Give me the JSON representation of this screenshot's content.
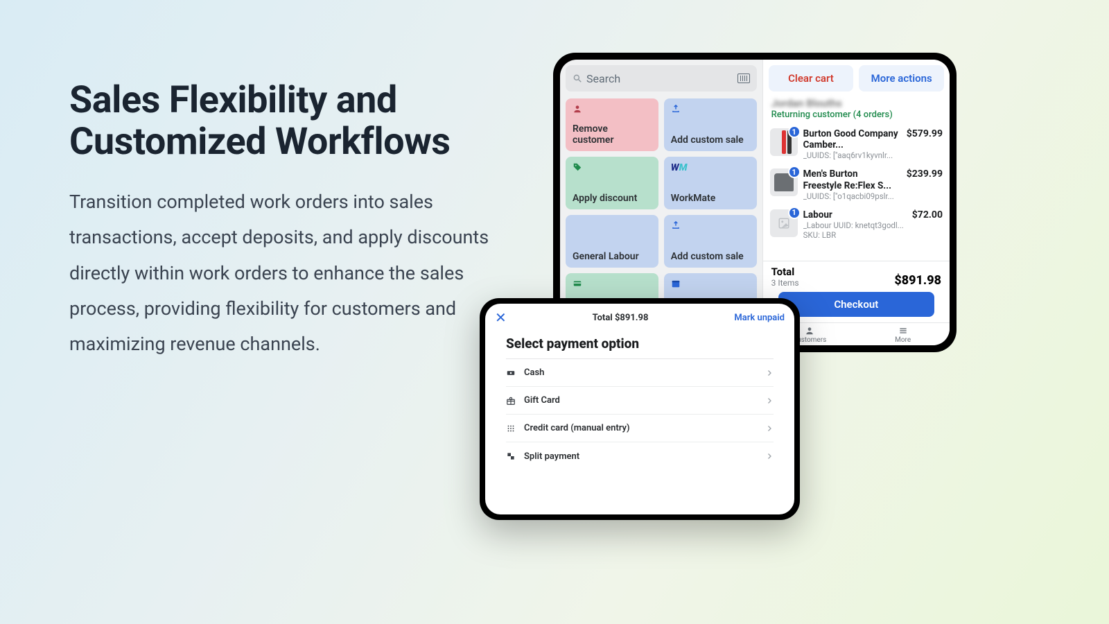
{
  "marketing": {
    "headline": "Sales Flexibility and Customized Workflows",
    "body": "Transition completed work orders into sales transactions, accept deposits, and apply discounts directly within work orders to enhance the sales process, providing flexibility for customers and maximizing revenue channels."
  },
  "pos": {
    "search_placeholder": "Search",
    "tiles": [
      {
        "label": "Remove customer",
        "icon": "person-icon",
        "color": "tile-pink"
      },
      {
        "label": "Add custom sale",
        "icon": "upload-icon",
        "color": "tile-blue"
      },
      {
        "label": "Apply discount",
        "icon": "tag-icon",
        "color": "tile-green"
      },
      {
        "label": "WorkMate",
        "icon": "workmate-logo",
        "color": "tile-blue2"
      },
      {
        "label": "General Labour",
        "icon": "",
        "color": "tile-blue"
      },
      {
        "label": "Add custom sale",
        "icon": "upload-icon",
        "color": "tile-blue"
      },
      {
        "label": "",
        "icon": "card-icon",
        "color": "tile-green"
      },
      {
        "label": "",
        "icon": "calendar-icon",
        "color": "tile-blue"
      }
    ],
    "cart": {
      "clear_label": "Clear cart",
      "more_label": "More actions",
      "customer_name_blurred": "Jordan Blouths",
      "customer_status": "Returning customer (4 orders)",
      "items": [
        {
          "qty": 1,
          "title": "Burton Good Company Camber...",
          "sub": "_UUIDS: [\"aaq6rv1kyvnlr...",
          "price": "$579.99",
          "thumb": "ski"
        },
        {
          "qty": 1,
          "title": "Men's Burton Freestyle Re:Flex S...",
          "sub": "_UUIDS: [\"o1qacbi09pslr...",
          "price": "$239.99",
          "thumb": "boot"
        },
        {
          "qty": 1,
          "title": "Labour",
          "sub": "_Labour UUID: knetqt3godl...",
          "sub2": "SKU: LBR",
          "price": "$72.00",
          "thumb": "placeholder"
        }
      ],
      "total_label": "Total",
      "items_count_label": "3 Items",
      "total_amount": "$891.98",
      "checkout_label": "Checkout"
    },
    "nav": {
      "customers": "Customers",
      "more": "More"
    }
  },
  "payment": {
    "close_glyph": "✕",
    "header_total": "Total $891.98",
    "mark_unpaid": "Mark unpaid",
    "select_heading": "Select payment option",
    "options": [
      {
        "label": "Cash",
        "icon": "cash-icon"
      },
      {
        "label": "Gift Card",
        "icon": "gift-icon"
      },
      {
        "label": "Credit card (manual entry)",
        "icon": "keypad-icon"
      },
      {
        "label": "Split payment",
        "icon": "split-icon"
      }
    ]
  }
}
